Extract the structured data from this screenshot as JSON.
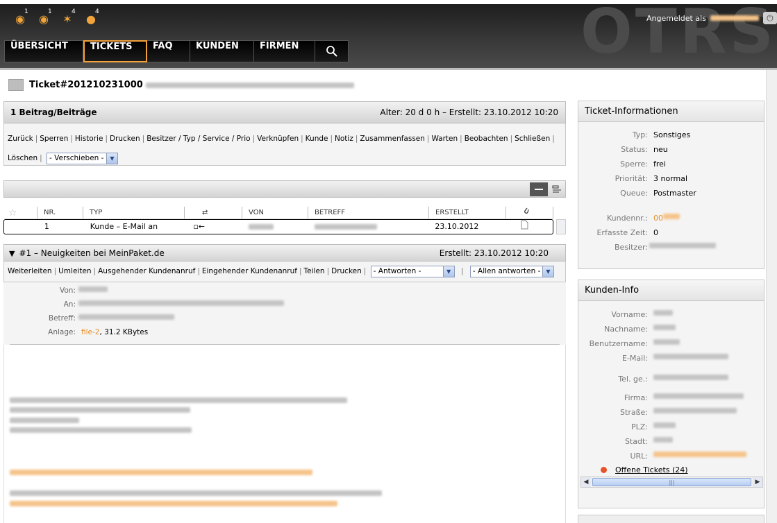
{
  "header": {
    "logo": "OTRS",
    "login_label": "Angemeldet als",
    "status_icons": [
      {
        "name": "locked-watched-icon",
        "count": "1"
      },
      {
        "name": "watched-icon",
        "count": "1"
      },
      {
        "name": "responsible-icon",
        "count": "4"
      },
      {
        "name": "user-icon",
        "count": "4"
      }
    ],
    "nav": [
      "ÜBERSICHT",
      "TICKETS",
      "FAQ",
      "KUNDEN",
      "FIRMEN"
    ],
    "active_nav": "TICKETS"
  },
  "ticket": {
    "title": "Ticket#201210231000"
  },
  "main": {
    "article_count": "1 Beitrag/Beiträge",
    "age_created": "Alter: 20 d 0 h – Erstellt: 23.10.2012 10:20",
    "actions": [
      "Zurück",
      "Sperren",
      "Historie",
      "Drucken",
      "Besitzer / Typ / Service / Prio",
      "Verknüpfen",
      "Kunde",
      "Notiz",
      "Zusammenfassen",
      "Warten",
      "Beobachten",
      "Schließen"
    ],
    "delete": "Löschen",
    "move_select": "- Verschieben -"
  },
  "article_table": {
    "headers": [
      "NR.",
      "TYP",
      "VON",
      "BETREFF",
      "ERSTELLT"
    ],
    "row": {
      "nr": "1",
      "typ": "Kunde – E-Mail an",
      "erstellt": "23.10.2012"
    }
  },
  "article": {
    "title": "#1 – Neuigkeiten bei MeinPaket.de",
    "created": "Erstellt: 23.10.2012 10:20",
    "actions": [
      "Weiterleiten",
      "Umleiten",
      "Ausgehender Kundenanruf",
      "Eingehender Kundenanruf",
      "Teilen",
      "Drucken"
    ],
    "reply_select": "- Antworten -",
    "reply_all_select": "- Allen antworten -",
    "labels": {
      "from": "Von:",
      "to": "An:",
      "subject": "Betreff:",
      "attachment": "Anlage:"
    },
    "attachment_name": "file-2",
    "attachment_size": ", 31.2 KBytes"
  },
  "ticket_info": {
    "title": "Ticket-Informationen",
    "rows": [
      {
        "label": "Typ:",
        "value": "Sonstiges"
      },
      {
        "label": "Status:",
        "value": "neu"
      },
      {
        "label": "Sperre:",
        "value": "frei"
      },
      {
        "label": "Priorität:",
        "value": "3 normal"
      },
      {
        "label": "Queue:",
        "value": "Postmaster"
      }
    ],
    "customer_no_label": "Kundennr.:",
    "customer_no_prefix": "00",
    "time_label": "Erfasste Zeit:",
    "time_value": "0",
    "owner_label": "Besitzer:"
  },
  "customer_info": {
    "title": "Kunden-Info",
    "labels": [
      "Vorname:",
      "Nachname:",
      "Benutzername:",
      "E-Mail:",
      "Tel. ge.:",
      "Firma:",
      "Straße:",
      "PLZ:",
      "Stadt:",
      "URL:"
    ],
    "open_tickets": "Offene Tickets (24)"
  },
  "colors": {
    "accent": "#f4a13a",
    "header_bg": "#2a2a2a",
    "open_dot": "#e8522a"
  }
}
